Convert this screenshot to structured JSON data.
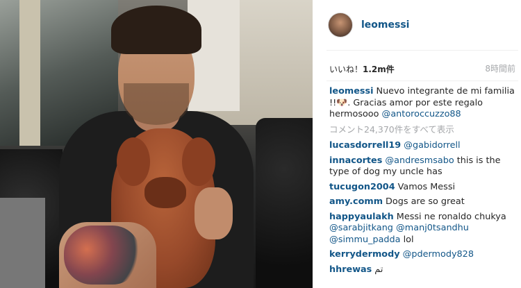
{
  "post": {
    "username": "leomessi",
    "likes_label": "いいね！",
    "likes_count": "1.2m件",
    "time_ago": "8時間前",
    "caption": {
      "user": "leomessi",
      "text": "Nuevo integrante de mi familia !!🐶. Gracias amor por este regalo hermosooo ",
      "mention": "@antoroccuzzo88"
    },
    "view_all_comments": "コメント24,370件をすべて表示",
    "comments": [
      {
        "user": "lucasdorrell19",
        "mention": "@gabidorrell",
        "text": ""
      },
      {
        "user": "innacortes",
        "mention": "@andresmsabo",
        "text": " this is the type of dog my uncle has"
      },
      {
        "user": "tucugon2004",
        "mention": "",
        "text": "Vamos Messi"
      },
      {
        "user": "amy.comm",
        "mention": "",
        "text": "Dogs are so great"
      },
      {
        "user": "happyaulakh",
        "mention": "",
        "text": "Messi ne ronaldo chukya @sarabjitkang @manj0tsandhu @simmu_padda lol"
      },
      {
        "user": "kerrydermody",
        "mention": "@pdermody828",
        "text": ""
      },
      {
        "user": "hhrewas",
        "mention": "",
        "text": "تم"
      }
    ]
  },
  "colors": {
    "link_blue": "#125688",
    "muted_gray": "#a5a7aa",
    "text": "#262626"
  },
  "icons": {
    "avatar": "profile-avatar"
  }
}
